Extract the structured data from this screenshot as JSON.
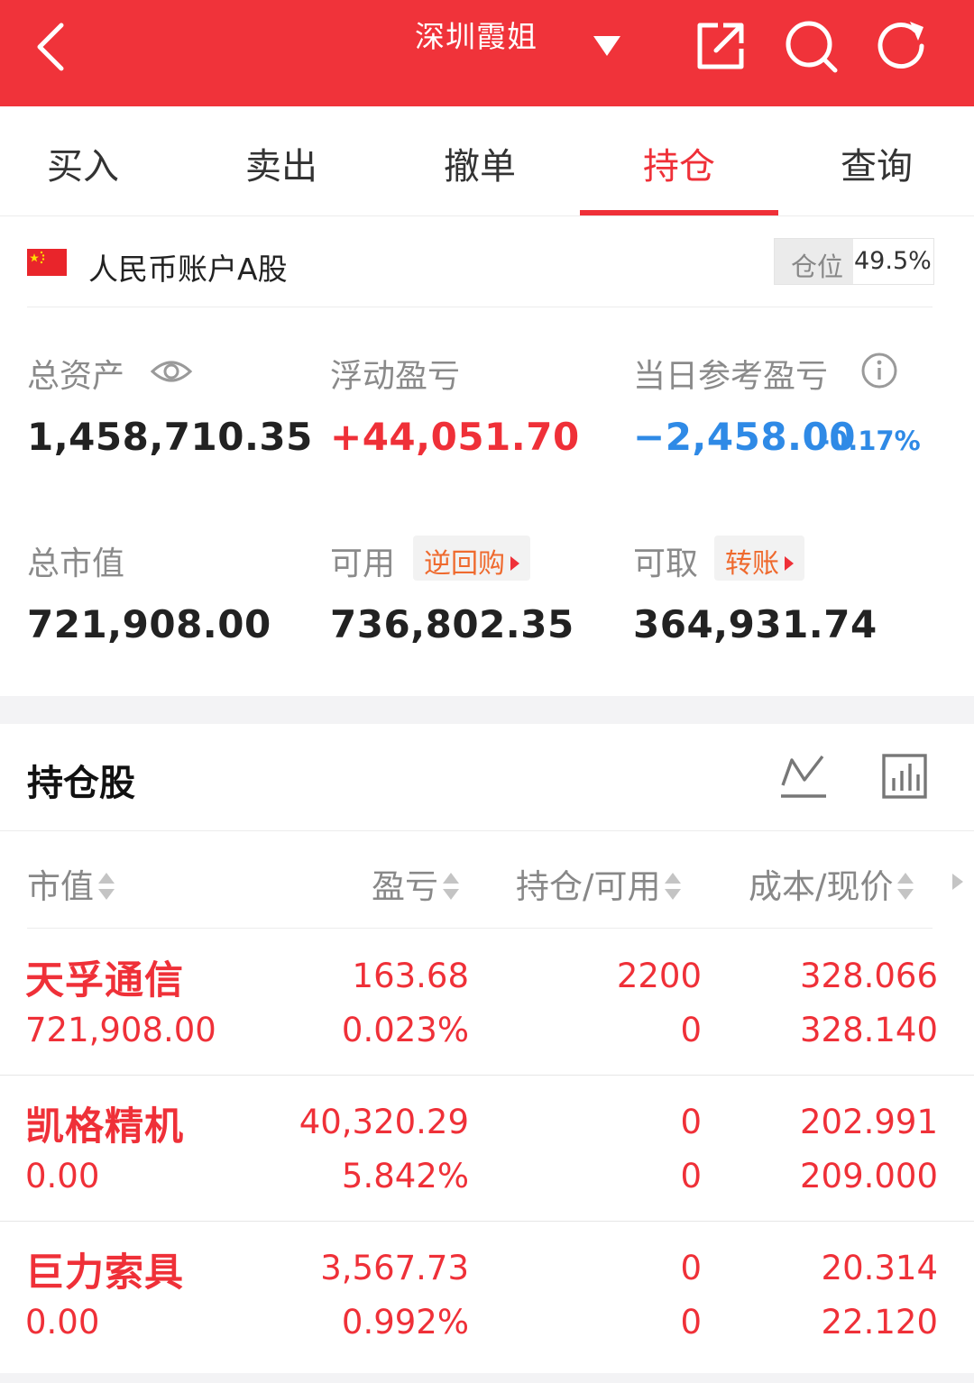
{
  "header": {
    "title": "深圳霞姐",
    "icons": [
      "back-icon",
      "dropdown-caret-icon",
      "share-icon",
      "search-icon",
      "refresh-icon"
    ],
    "color": "#f0333a"
  },
  "tabs": [
    {
      "label": "买入",
      "active": false
    },
    {
      "label": "卖出",
      "active": false
    },
    {
      "label": "撤单",
      "active": false
    },
    {
      "label": "持仓",
      "active": true
    },
    {
      "label": "查询",
      "active": false
    }
  ],
  "account": {
    "name": "人民币账户A股",
    "position_label": "仓位",
    "position_value": "49.5%",
    "total_assets_label": "总资产",
    "total_assets": "1,458,710.35",
    "float_pl_label": "浮动盈亏",
    "float_pl": "+44,051.70",
    "daily_pl_label": "当日参考盈亏",
    "daily_pl": "−2,458.00",
    "daily_pl_pct": "-0.17%",
    "market_value_label": "总市值",
    "market_value": "721,908.00",
    "available_label": "可用",
    "reverse_repo_label": "逆回购",
    "available": "736,802.35",
    "withdrawable_label": "可取",
    "transfer_label": "转账",
    "withdrawable": "364,931.74"
  },
  "holdings": {
    "title": "持仓股",
    "columns": [
      "市值",
      "盈亏",
      "持仓/可用",
      "成本/现价"
    ],
    "rows": [
      {
        "name": "天孚通信",
        "market_value": "721,908.00",
        "pl": "163.68",
        "pl_pct": "0.023%",
        "position": "2200",
        "available": "0",
        "cost": "328.066",
        "price": "328.140"
      },
      {
        "name": "凯格精机",
        "market_value": "0.00",
        "pl": "40,320.29",
        "pl_pct": "5.842%",
        "position": "0",
        "available": "0",
        "cost": "202.991",
        "price": "209.000"
      },
      {
        "name": "巨力索具",
        "market_value": "0.00",
        "pl": "3,567.73",
        "pl_pct": "0.992%",
        "position": "0",
        "available": "0",
        "cost": "20.314",
        "price": "22.120"
      }
    ]
  }
}
